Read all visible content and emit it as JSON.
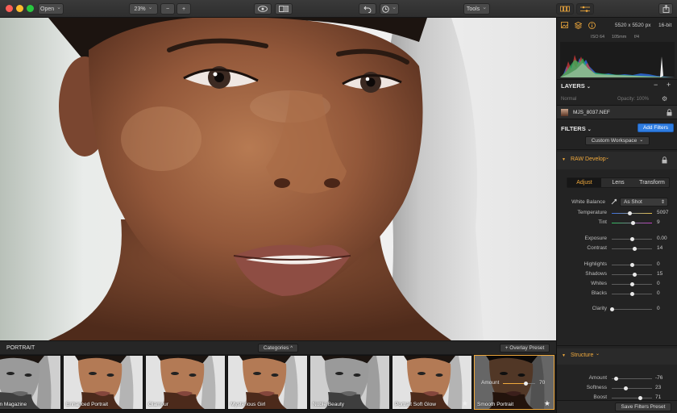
{
  "toolbar": {
    "open_label": "Open",
    "zoom_value": "23%",
    "zoom_out": "−",
    "zoom_in": "+",
    "tools_label": "Tools"
  },
  "info": {
    "dimensions": "5520 x 5520 px",
    "bit_depth": "16-bit",
    "iso": "ISO 64",
    "focal": "105mm",
    "aperture": "f/4"
  },
  "layers": {
    "title": "LAYERS",
    "blend_mode": "Normal",
    "opacity_label": "Opacity: 100%",
    "file_name": "MJS_8037.NEF",
    "minus": "−",
    "plus": "+"
  },
  "filters": {
    "title": "FILTERS",
    "add_button": "Add Filters",
    "workspace": "Custom Workspace"
  },
  "raw": {
    "title": "RAW Develop",
    "tabs": [
      "Adjust",
      "Lens",
      "Transform"
    ],
    "white_balance_label": "White Balance",
    "white_balance_value": "As Shot",
    "sliders": [
      {
        "label": "Temperature",
        "value": "5097",
        "pos": 0.45
      },
      {
        "label": "Tint",
        "value": "9",
        "pos": 0.52
      },
      {
        "label": "Exposure",
        "value": "0.00",
        "pos": 0.5
      },
      {
        "label": "Contrast",
        "value": "14",
        "pos": 0.56
      },
      {
        "label": "Highlights",
        "value": "0",
        "pos": 0.5
      },
      {
        "label": "Shadows",
        "value": "15",
        "pos": 0.56
      },
      {
        "label": "Whites",
        "value": "0",
        "pos": 0.5
      },
      {
        "label": "Blacks",
        "value": "0",
        "pos": 0.5
      },
      {
        "label": "Clarity",
        "value": "0",
        "pos": 0.0
      }
    ]
  },
  "structure": {
    "title": "Structure",
    "sliders": [
      {
        "label": "Amount",
        "value": "-76",
        "pos": 0.1
      },
      {
        "label": "Softness",
        "value": "23",
        "pos": 0.35
      },
      {
        "label": "Boost",
        "value": "71",
        "pos": 0.7
      }
    ],
    "save_preset": "Save Filters Preset"
  },
  "presets": {
    "category": "PORTRAIT",
    "categories_label": "Categories",
    "overlay_label": "+ Overlay Preset",
    "items": [
      {
        "name": "Fashion Magazine",
        "mono": true
      },
      {
        "name": "Enhanced Portrait",
        "mono": false
      },
      {
        "name": "Glamour",
        "mono": false
      },
      {
        "name": "Mysterious Girl",
        "mono": false
      },
      {
        "name": "Noble Beauty",
        "mono": true
      },
      {
        "name": "Portrait Soft Glow",
        "mono": false
      },
      {
        "name": "Smooth Portrait",
        "mono": false
      }
    ],
    "selected_amount_label": "Amount",
    "selected_amount_value": "70",
    "selected_amount_pos": 0.7
  },
  "colors": {
    "accent": "#f0a93c",
    "blue": "#2f7de1"
  }
}
